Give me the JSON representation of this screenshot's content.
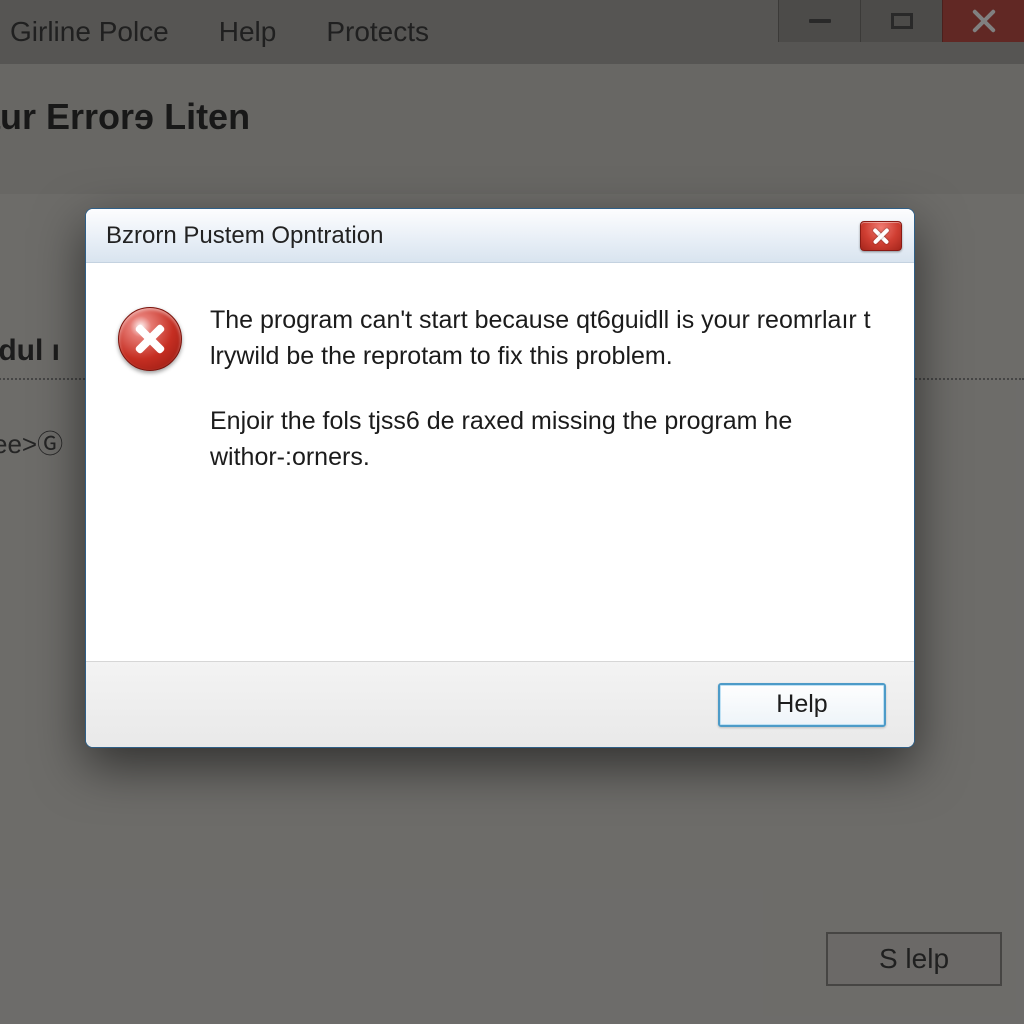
{
  "background": {
    "menubar": {
      "items": [
        "Girline Polce",
        "Help",
        "Protects"
      ]
    },
    "page_title": "aur Errorɘ Liten",
    "section_title": "udul ı",
    "line2": "see>Ⓖ",
    "footer_button_label": "S lelp"
  },
  "dialog": {
    "title": "Bzrorn Pustem Opntration",
    "message_p1": "The program can't start because qt6guidll is your reomrlaır t lrywild be the reprotam to fix this problem.",
    "message_p2": "Enjoir the fols tjss6 de raxed missing the program he withor-:orners.",
    "help_button_label": "Help"
  },
  "colors": {
    "modal_border": "#2f5f87",
    "close_red": "#cf3e32",
    "error_red": "#c52e22"
  }
}
